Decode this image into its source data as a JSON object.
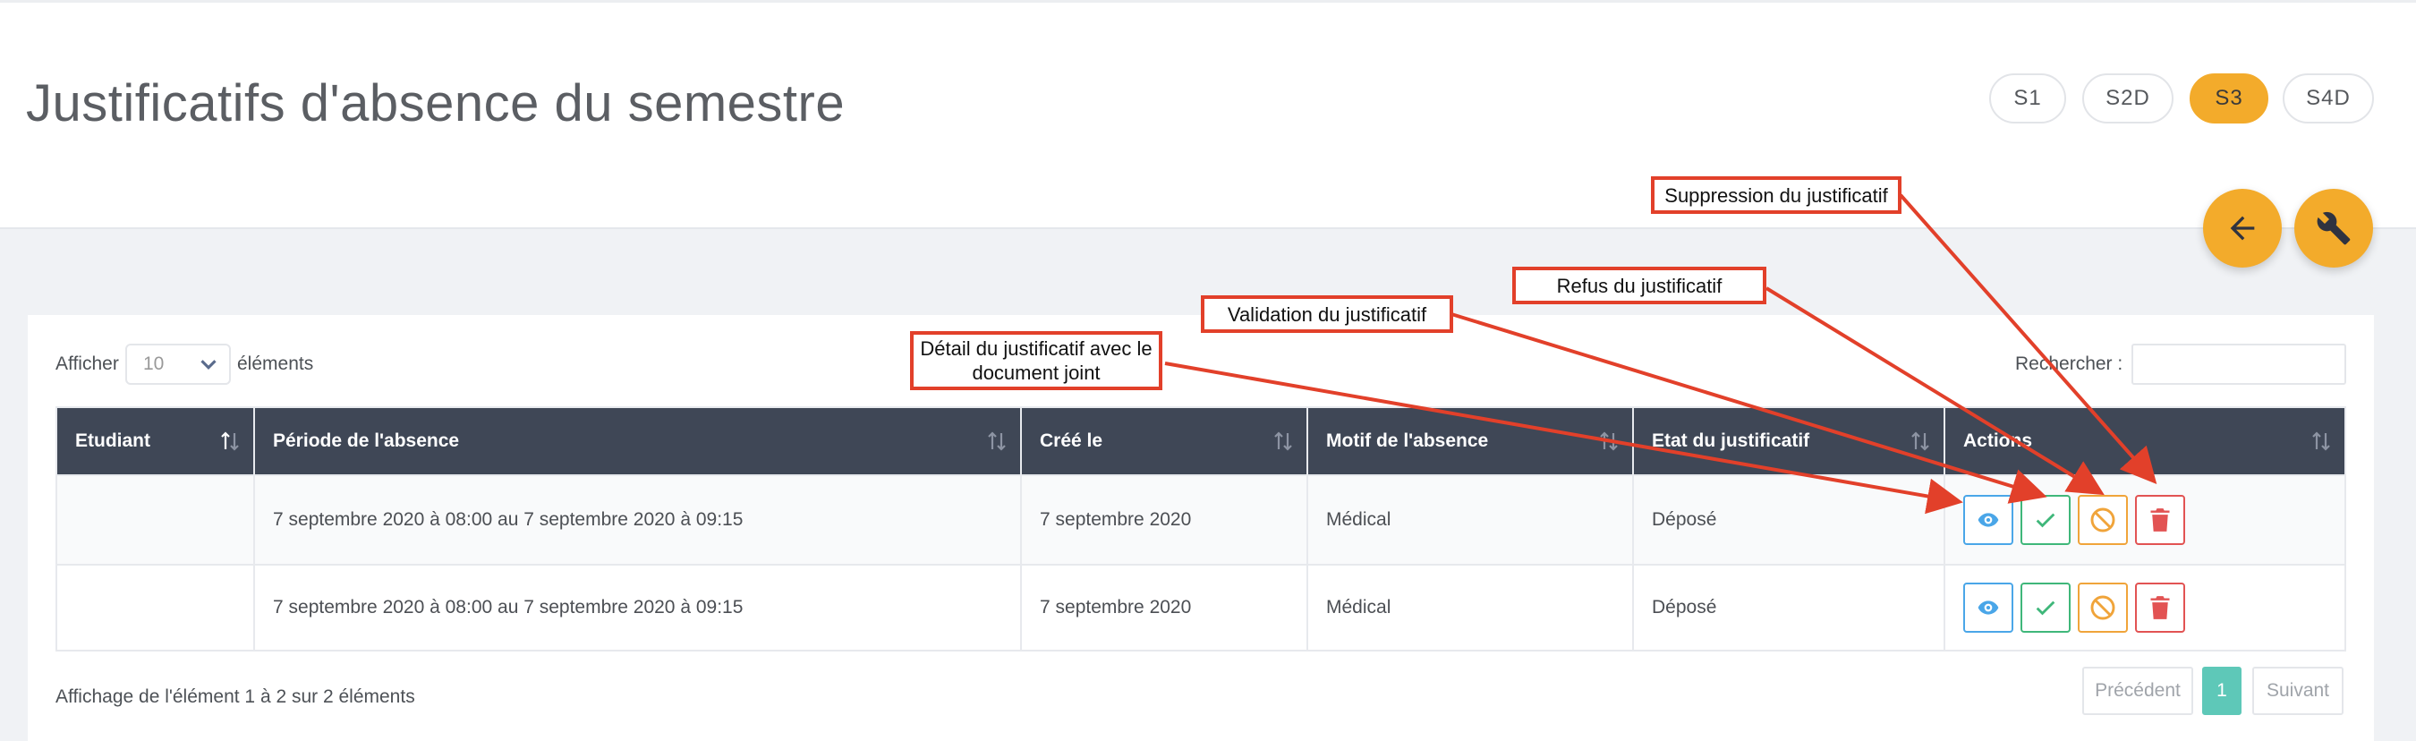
{
  "page": {
    "title": "Justificatifs d'absence du semestre",
    "semesters": [
      {
        "label": "S1",
        "active": false
      },
      {
        "label": "S2D",
        "active": false
      },
      {
        "label": "S3",
        "active": true
      },
      {
        "label": "S4D",
        "active": false
      }
    ],
    "fabs": [
      "arrow-left-icon",
      "wrench-icon"
    ]
  },
  "controls": {
    "show_label": "Afficher",
    "page_size": "10",
    "elements_label": "éléments",
    "search_label": "Rechercher :",
    "search_value": ""
  },
  "table": {
    "columns": [
      "Etudiant",
      "Période de l'absence",
      "Créé le",
      "Motif de l'absence",
      "Etat du justificatif",
      "Actions"
    ],
    "rows": [
      {
        "etudiant": "",
        "periode": "7 septembre 2020 à 08:00 au 7 septembre 2020 à 09:15",
        "cree_le": "7 septembre 2020",
        "motif": "Médical",
        "etat": "Déposé"
      },
      {
        "etudiant": "",
        "periode": "7 septembre 2020 à 08:00 au 7 septembre 2020 à 09:15",
        "cree_le": "7 septembre 2020",
        "motif": "Médical",
        "etat": "Déposé"
      }
    ],
    "actions": [
      "eye-icon",
      "check-icon",
      "ban-icon",
      "trash-icon"
    ]
  },
  "footer": {
    "info": "Affichage de l'élément 1 à 2 sur 2 éléments",
    "prev": "Précédent",
    "page": "1",
    "next": "Suivant"
  },
  "annotations": {
    "detail": "Détail du justificatif avec le document joint",
    "validation": "Validation du justificatif",
    "refus": "Refus du justificatif",
    "suppression": "Suppression du justificatif"
  },
  "colors": {
    "accent": "#f3ab2b",
    "header": "#3f4756",
    "view": "#4aa6e8",
    "validate": "#3fb77a",
    "refuse": "#f0a43a",
    "delete": "#e25353",
    "annotation": "#e2402a",
    "pager_active": "#5ec8b8"
  }
}
